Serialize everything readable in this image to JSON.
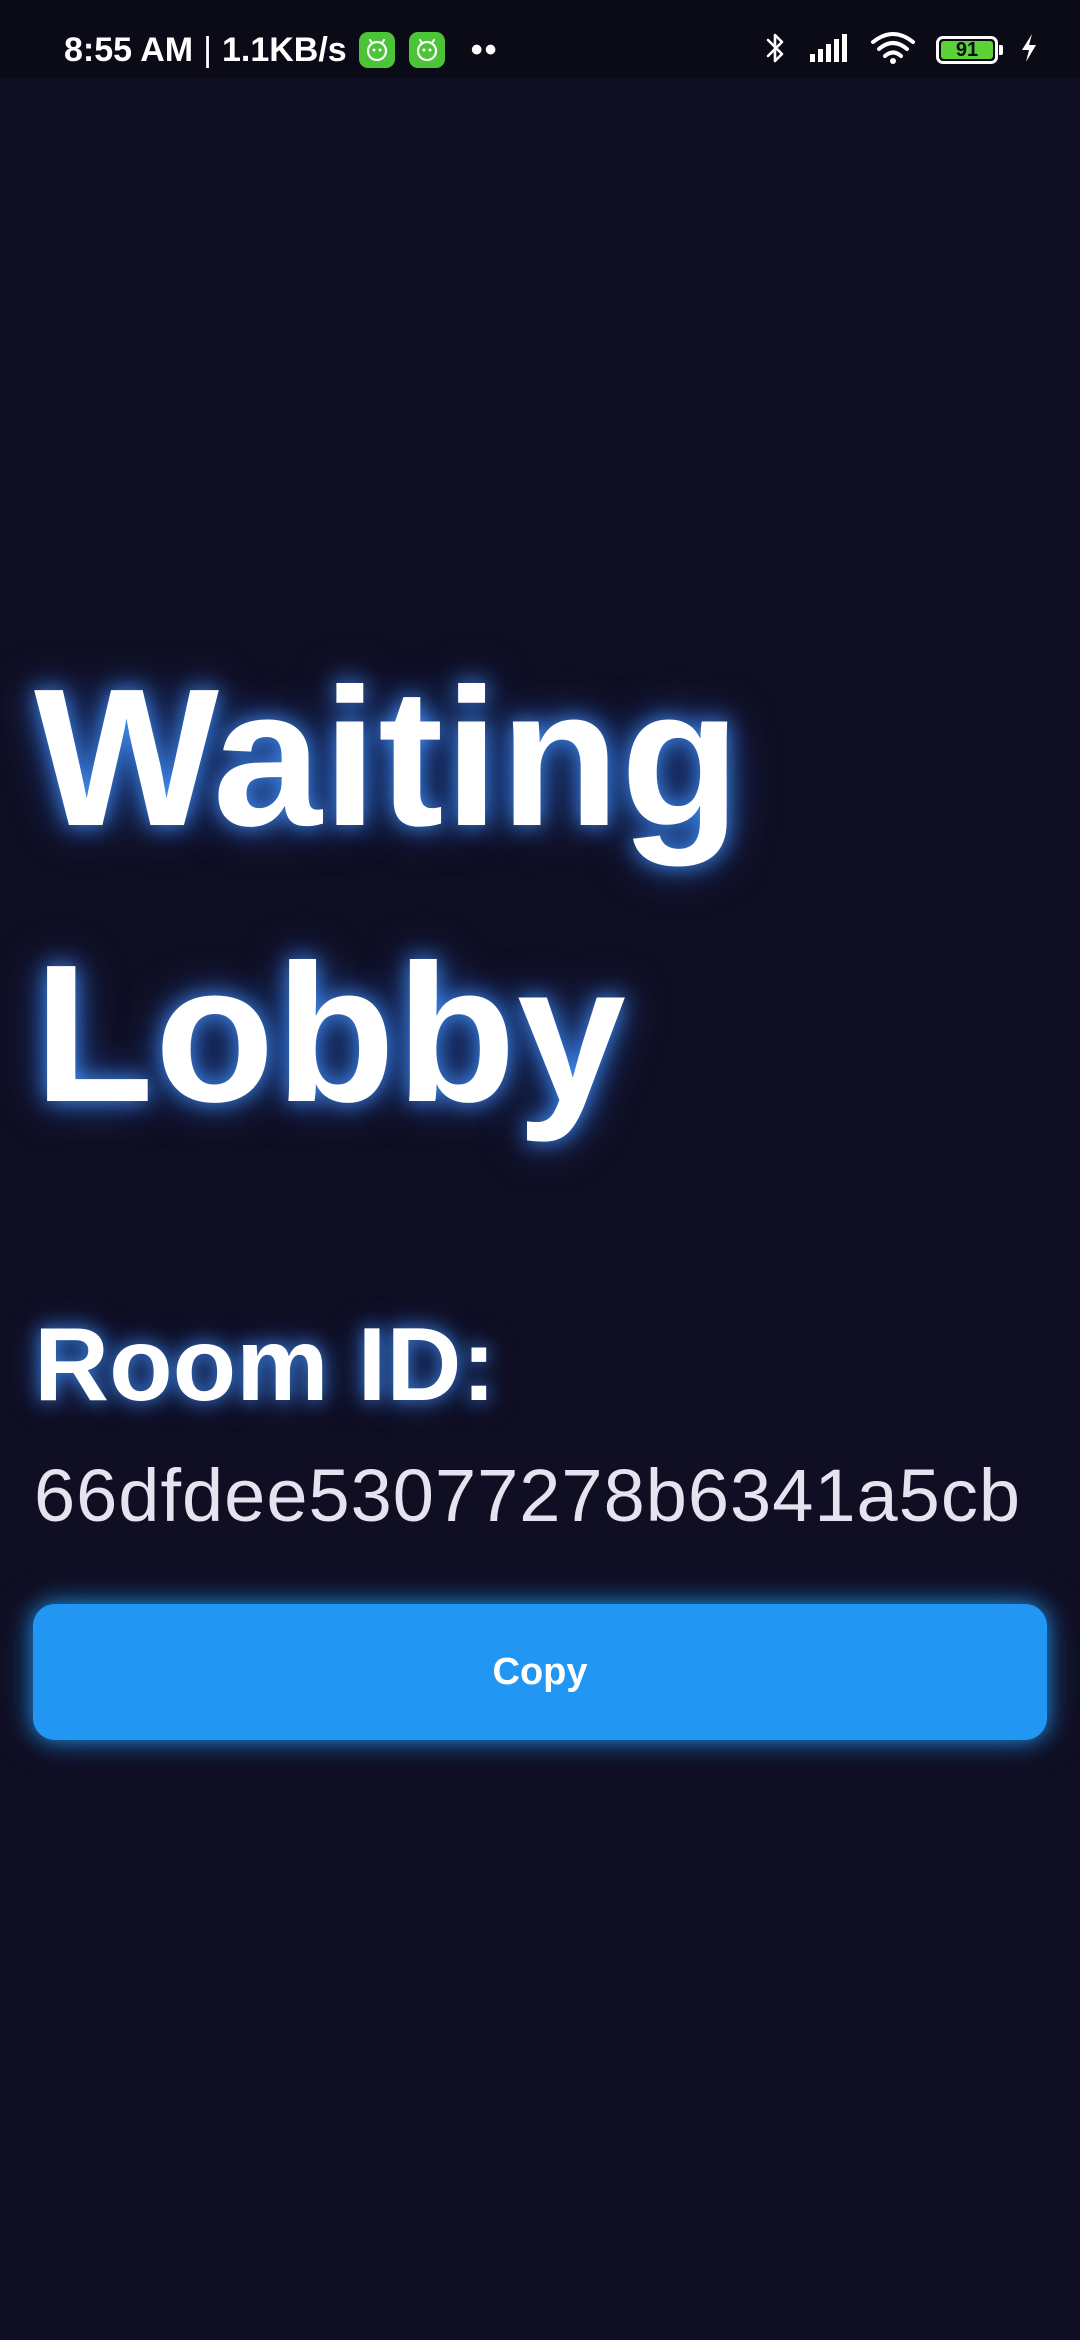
{
  "status_bar": {
    "time": "8:55 AM",
    "separator": "|",
    "network_speed": "1.1KB/s",
    "app_icons": [
      "android-app-icon",
      "android-app-icon"
    ],
    "more_dots": "••",
    "battery_level": "91",
    "icons": [
      "bluetooth-icon",
      "signal-icon",
      "wifi-icon",
      "battery-icon",
      "charging-icon"
    ],
    "battery_color": "#5bd235"
  },
  "main": {
    "title_line1": "Waiting",
    "title_line2": "Lobby",
    "room_label": "Room ID:",
    "room_id": "66dfdee53077278b6341a5cb",
    "copy_button_label": "Copy"
  },
  "colors": {
    "background": "#100e22",
    "accent": "#2196f3",
    "glow": "#4696ff"
  }
}
